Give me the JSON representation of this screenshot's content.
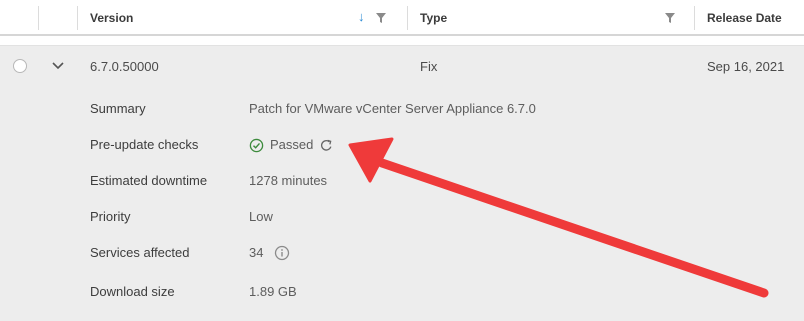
{
  "table": {
    "columns": {
      "version": "Version",
      "type": "Type",
      "release_date": "Release Date"
    },
    "row": {
      "version": "6.7.0.50000",
      "type": "Fix",
      "release_date": "Sep 16, 2021"
    }
  },
  "details": {
    "summary_label": "Summary",
    "summary_value": "Patch for VMware vCenter Server Appliance 6.7.0",
    "checks_label": "Pre-update checks",
    "checks_value": "Passed",
    "downtime_label": "Estimated downtime",
    "downtime_value": "1278 minutes",
    "priority_label": "Priority",
    "priority_value": "Low",
    "services_label": "Services affected",
    "services_value": "34",
    "download_label": "Download size",
    "download_value": "1.89 GB"
  },
  "icons": {
    "sort": "sort-descending-icon",
    "filter": "filter-icon",
    "expand": "chevron-down-icon",
    "passed": "check-circle-icon",
    "refresh": "refresh-icon",
    "info": "info-icon"
  },
  "colors": {
    "sort_arrow": "#2a8ad4",
    "passed_green": "#3c8a3c",
    "annotation_arrow": "#ef3a3a"
  }
}
